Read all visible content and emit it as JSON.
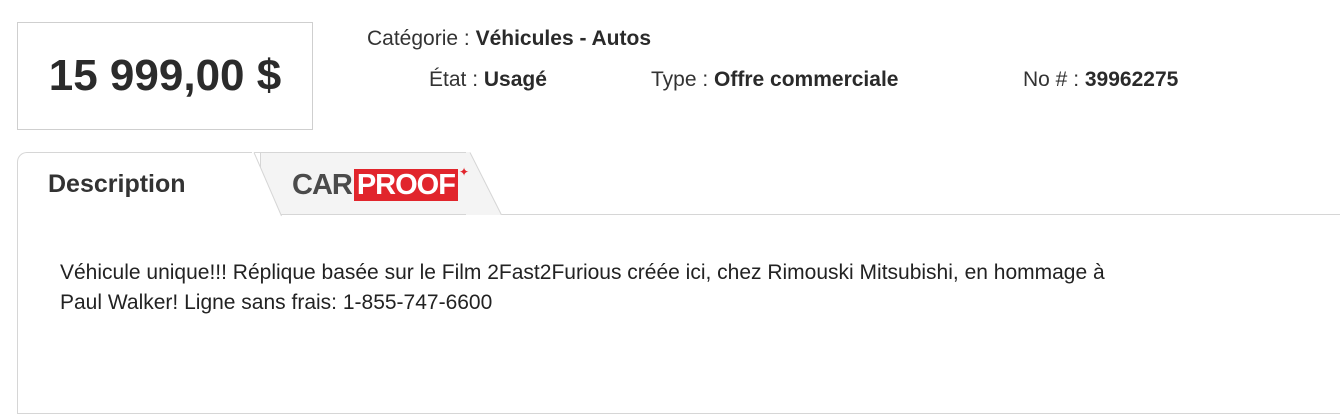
{
  "price": "15 999,00 $",
  "meta": {
    "categorie_label": "Catégorie :",
    "categorie_value": "Véhicules - Autos",
    "etat_label": "État :",
    "etat_value": "Usagé",
    "type_label": "Type :",
    "type_value": "Offre commerciale",
    "no_label": "No # :",
    "no_value": "39962275"
  },
  "tabs": {
    "description_label": "Description",
    "carproof_logo": {
      "car": "CAR",
      "proof": "PROOF",
      "leaf": "✦",
      "brand_red": "#e1252c"
    }
  },
  "description": {
    "line1": "Véhicule unique!!! Réplique basée sur le Film 2Fast2Furious créée ici, chez Rimouski Mitsubishi, en hommage à",
    "line2": "Paul Walker! Ligne sans frais: 1-855-747-6600"
  }
}
